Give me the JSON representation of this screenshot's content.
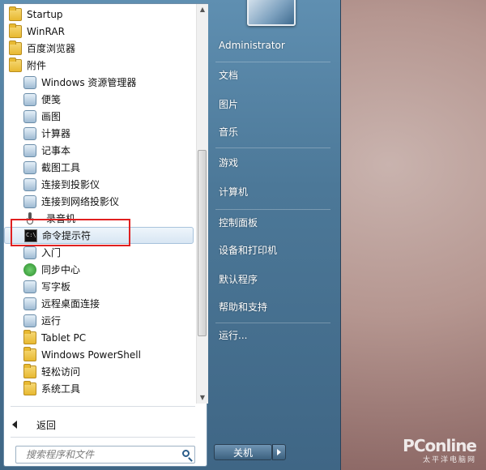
{
  "programs": [
    {
      "label": "Startup",
      "icon": "folder-icon",
      "level": 0
    },
    {
      "label": "WinRAR",
      "icon": "folder-icon",
      "level": 0
    },
    {
      "label": "百度浏览器",
      "icon": "folder-icon",
      "level": 0
    },
    {
      "label": "附件",
      "icon": "folder-icon",
      "level": 0
    },
    {
      "label": "Windows 资源管理器",
      "icon": "explorer-icon",
      "level": 1
    },
    {
      "label": "便笺",
      "icon": "sticky-notes-icon",
      "level": 1
    },
    {
      "label": "画图",
      "icon": "paint-icon",
      "level": 1
    },
    {
      "label": "计算器",
      "icon": "calculator-icon",
      "level": 1
    },
    {
      "label": "记事本",
      "icon": "notepad-icon",
      "level": 1
    },
    {
      "label": "截图工具",
      "icon": "snipping-tool-icon",
      "level": 1
    },
    {
      "label": "连接到投影仪",
      "icon": "projector-icon",
      "level": 1
    },
    {
      "label": "连接到网络投影仪",
      "icon": "network-projector-icon",
      "level": 1
    },
    {
      "label": "录音机",
      "icon": "microphone-icon",
      "level": 1
    },
    {
      "label": "命令提示符",
      "icon": "command-prompt-icon",
      "level": 1,
      "selected": true
    },
    {
      "label": "入门",
      "icon": "getting-started-icon",
      "level": 1
    },
    {
      "label": "同步中心",
      "icon": "sync-center-icon",
      "level": 1
    },
    {
      "label": "写字板",
      "icon": "wordpad-icon",
      "level": 1
    },
    {
      "label": "远程桌面连接",
      "icon": "remote-desktop-icon",
      "level": 1
    },
    {
      "label": "运行",
      "icon": "run-icon",
      "level": 1
    },
    {
      "label": "Tablet PC",
      "icon": "folder-icon",
      "level": 1
    },
    {
      "label": "Windows PowerShell",
      "icon": "folder-icon",
      "level": 1
    },
    {
      "label": "轻松访问",
      "icon": "folder-icon",
      "level": 1
    },
    {
      "label": "系统工具",
      "icon": "folder-icon",
      "level": 1
    }
  ],
  "back_label": "返回",
  "search_placeholder": "搜索程序和文件",
  "right": {
    "user": "Administrator",
    "items": [
      "文档",
      "图片",
      "音乐",
      "游戏",
      "计算机",
      "控制面板",
      "设备和打印机",
      "默认程序",
      "帮助和支持",
      "运行..."
    ]
  },
  "shutdown_label": "关机",
  "watermark": {
    "brand": "PConline",
    "sub": "太平洋电脑网"
  },
  "colors": {
    "highlight": "#e02020",
    "selection": "#d8e6f3",
    "panel": "#4c7898"
  }
}
